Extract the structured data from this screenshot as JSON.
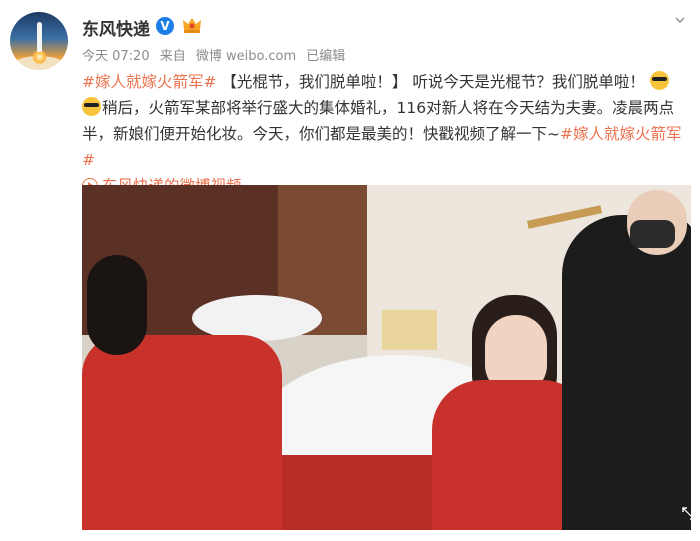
{
  "post": {
    "username": "东风快递",
    "timestamp": "今天 07:20",
    "source_prefix": "来自",
    "source": "微博 weibo.com",
    "edited": "已编辑",
    "topic": "#嫁人就嫁火箭军#",
    "headline": "【光棍节，我们脱单啦！】",
    "text_1": "听说今天是光棍节？我们脱单啦！",
    "text_2": "稍后，火箭军某部将举行盛大的集体婚礼，116对新人将在今天结为夫妻。凌晨两点半，新娘们便开始化妆。今天，你们都是最美的！快戳视频了解一下~",
    "topic_end": "#嫁人就嫁火箭军#",
    "video_link": "东风快递的微博视频"
  },
  "icons": {
    "verified": "verified-badge-icon",
    "vip": "vip-crown-icon",
    "menu": "chevron-down-icon",
    "emoji": "sunglasses-emoji-icon",
    "video": "play-circle-icon",
    "expand": "expand-icon"
  },
  "colors": {
    "topic": "#eb7350",
    "text": "#333333",
    "meta": "#8c8c8c",
    "verified": "#1e7ee8"
  }
}
